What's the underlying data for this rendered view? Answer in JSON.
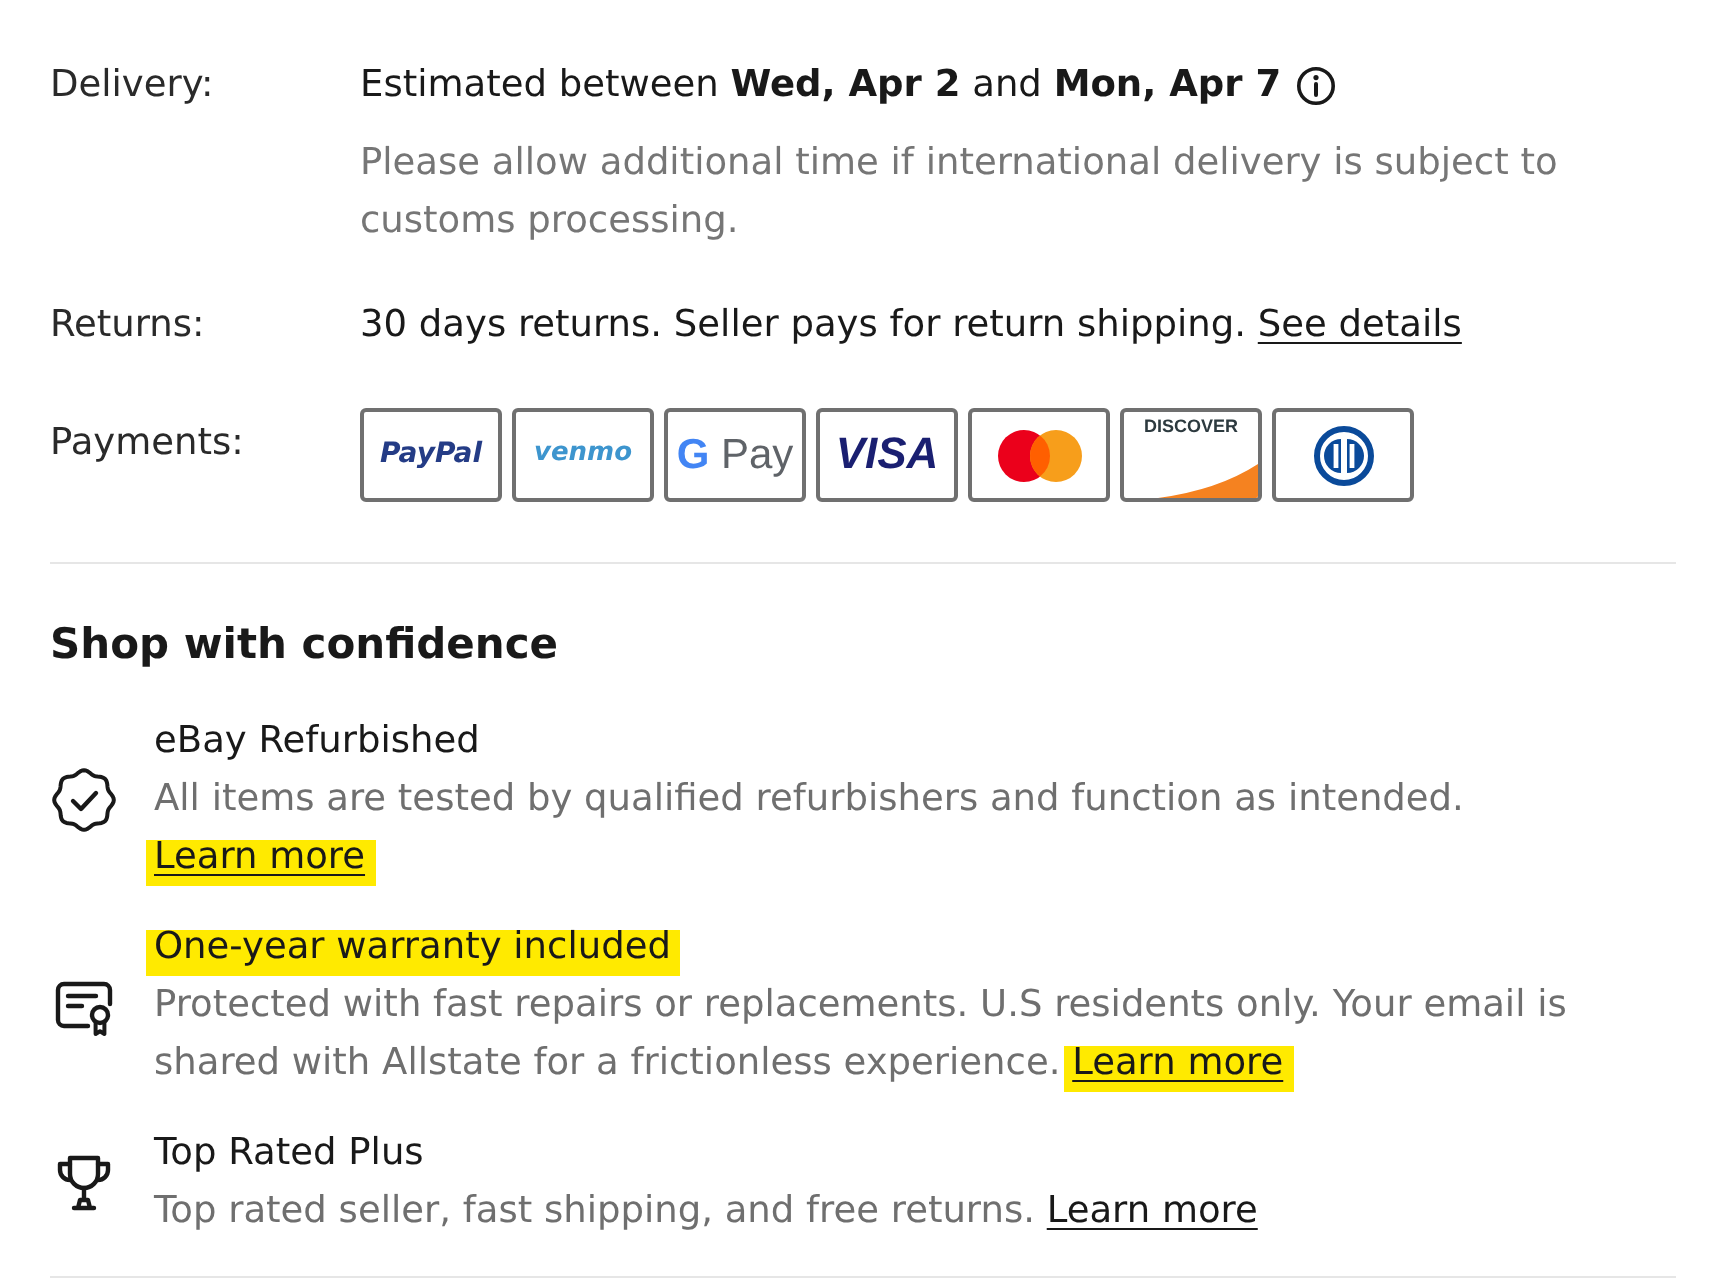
{
  "delivery": {
    "label": "Delivery:",
    "estimate": "Estimated between **Wed, Apr 2** and **Mon, Apr 7**",
    "note": "Please allow additional time if international delivery is subject to customs processing."
  },
  "returns": {
    "label": "Returns:",
    "text": "30 days returns. Seller pays for return shipping.",
    "link": "See details"
  },
  "payments": {
    "label": "Payments:",
    "methods": [
      {
        "kind": "paypal",
        "label": "PayPal"
      },
      {
        "kind": "venmo",
        "label": "venmo"
      },
      {
        "kind": "gpay",
        "mark": "G",
        "label": "Pay"
      },
      {
        "kind": "visa",
        "label": "VISA"
      },
      {
        "kind": "mastercard"
      },
      {
        "kind": "discover",
        "label": "DISCOVER"
      },
      {
        "kind": "diners"
      }
    ]
  },
  "confidence": {
    "title": "Shop with confidence",
    "items": [
      {
        "kind": "refurbished",
        "title": "eBay Refurbished",
        "title_highlighted": false,
        "text": "All items are tested by qualified refurbishers and function as intended.",
        "link": "Learn more",
        "link_highlighted": true
      },
      {
        "kind": "warranty",
        "title": "One-year warranty included",
        "title_highlighted": true,
        "text": "Protected with fast repairs or replacements. U.S residents only. Your email is shared with Allstate for a frictionless experience.",
        "link": "Learn more",
        "link_highlighted": true
      },
      {
        "kind": "top_rated",
        "title": "Top Rated Plus",
        "title_highlighted": false,
        "text": "Top rated seller, fast shipping, and free returns.",
        "link": "Learn more",
        "link_highlighted": false
      }
    ]
  }
}
